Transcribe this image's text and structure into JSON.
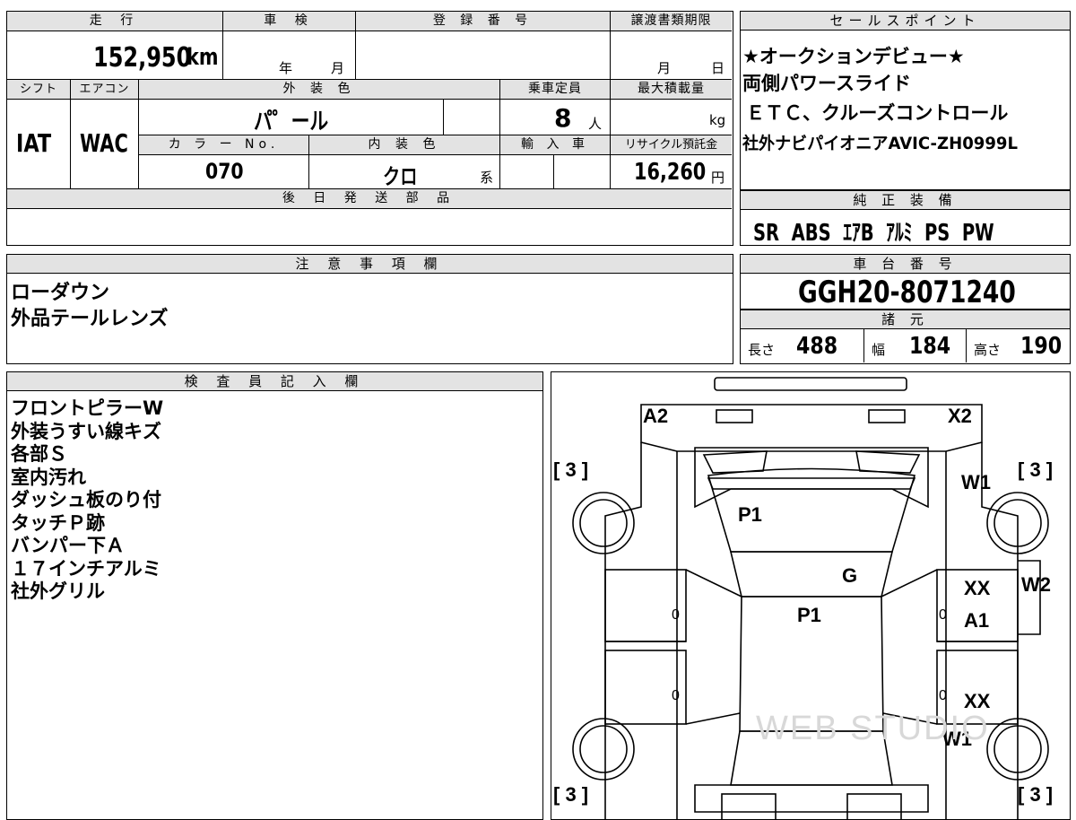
{
  "top": {
    "header": {
      "mileage": "走 行",
      "inspection": "車 検",
      "reg_no": "登 録 番 号",
      "transfer": "譲渡書類期限",
      "shift": "シフト",
      "aircon": "エアコン",
      "ext_color": "外 装 色",
      "capacity": "乗車定員",
      "max_load": "最大積載量",
      "color_no": "カ ラ ー No.",
      "int_color": "内 装 色",
      "import": "輸 入 車",
      "recycle": "リサイクル預託金",
      "later_parts": "後 日 発 送 部 品"
    },
    "mileage_value": "152,950",
    "mileage_unit": "km",
    "year_label": "年",
    "month_label": "月",
    "transfer_month": "月",
    "transfer_day": "日",
    "shift_value": "IAT",
    "aircon_value": "WAC",
    "ext_color_value": "パ゜ール",
    "capacity_value": "8",
    "capacity_unit": "人",
    "load_unit": "kg",
    "color_no_value": "070",
    "int_color_value": "クロ",
    "int_suffix": "系",
    "recycle_value": "16,260",
    "recycle_unit": "円"
  },
  "sales": {
    "header": "セールスポイント",
    "lines": [
      "★オークションデビュー★",
      "両側パワースライド",
      "ＥＴＣ、クルーズコントロール",
      "社外ナビパイオニアAVIC-ZH0999L"
    ]
  },
  "equipment": {
    "header": "純 正 装 備",
    "items": "SR  ABS  ｴｱB  ｱﾙﾐ  PS  PW"
  },
  "notes": {
    "header": "注 意 事 項 欄",
    "text": "ローダウン\n外品テールレンズ"
  },
  "chassis": {
    "header": "車 台 番 号",
    "value": "GGH20-8071240"
  },
  "specs": {
    "header": "諸 元",
    "len_label": "長さ",
    "len": "488",
    "wid_label": "幅",
    "wid": "184",
    "hei_label": "高さ",
    "hei": "190"
  },
  "inspector": {
    "header": "検 査 員 記 入 欄",
    "text": "フロントピラーW\n外装うすい線キズ\n各部Ｓ\n室内汚れ\nダッシュ板のり付\nタッチＰ跡\nバンパー下Ａ\n１７インチアルミ\n社外グリル"
  },
  "diagram": {
    "labels": {
      "a2": "A2",
      "x2": "X2",
      "w1_top": "W1",
      "p1_top": "P1",
      "g": "G",
      "xx_mid": "XX",
      "w2": "W2",
      "p1_mid": "P1",
      "a1": "A1",
      "xx_low": "XX",
      "w1_low": "W1",
      "zero": "0"
    },
    "bracket": "[ 3 ]",
    "watermark": "WEB STUDIO"
  }
}
